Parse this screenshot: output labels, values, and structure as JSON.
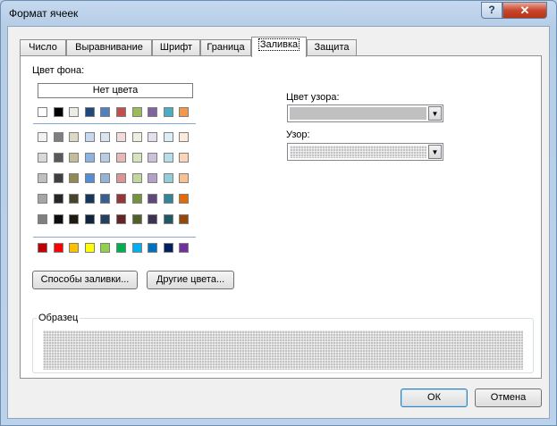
{
  "window": {
    "title": "Формат ячеек",
    "help_label": "?",
    "close_label": "✕"
  },
  "tabs": [
    {
      "label": "Число"
    },
    {
      "label": "Выравнивание"
    },
    {
      "label": "Шрифт"
    },
    {
      "label": "Граница"
    },
    {
      "label": "Заливка",
      "active": true
    },
    {
      "label": "Защита"
    }
  ],
  "fill": {
    "bg_color_label": "Цвет фона:",
    "no_color_label": "Нет цвета",
    "theme_row": [
      "#ffffff",
      "#000000",
      "#eeece1",
      "#1f497d",
      "#4f81bd",
      "#c0504d",
      "#9bbb59",
      "#8064a2",
      "#4bacc6",
      "#f79646"
    ],
    "shade_rows": [
      [
        "#f2f2f2",
        "#7f7f7f",
        "#ddd9c3",
        "#c6d9f0",
        "#dbe5f1",
        "#f2dcdb",
        "#ebf1dd",
        "#e5e0ec",
        "#dbeef3",
        "#fdeada"
      ],
      [
        "#d8d8d8",
        "#595959",
        "#c4bd97",
        "#8db3e2",
        "#b8cce4",
        "#e5b9b7",
        "#d7e3bc",
        "#ccc1d9",
        "#b7dde8",
        "#fbd5b5"
      ],
      [
        "#bfbfbf",
        "#3f3f3f",
        "#938953",
        "#548dd4",
        "#95b3d7",
        "#d99694",
        "#c3d69b",
        "#b2a2c7",
        "#92cddc",
        "#fac08f"
      ],
      [
        "#a5a5a5",
        "#262626",
        "#494429",
        "#17365d",
        "#366092",
        "#953734",
        "#76923c",
        "#5f497a",
        "#31859b",
        "#e36c09"
      ],
      [
        "#7f7f7f",
        "#0c0c0c",
        "#1d1b10",
        "#0f243e",
        "#244061",
        "#632423",
        "#4f6128",
        "#3f3151",
        "#205867",
        "#974806"
      ]
    ],
    "standard_row": [
      "#c00000",
      "#ff0000",
      "#ffc000",
      "#ffff00",
      "#92d050",
      "#00b050",
      "#00b0f0",
      "#0070c0",
      "#002060",
      "#7030a0"
    ],
    "fill_effects_label": "Способы заливки...",
    "more_colors_label": "Другие цвета...",
    "pattern_color_label": "Цвет узора:",
    "pattern_color_value": "#c0c0c0",
    "pattern_style_label": "Узор:",
    "sample_label": "Образец"
  },
  "footer": {
    "ok_label": "ОК",
    "cancel_label": "Отмена"
  }
}
